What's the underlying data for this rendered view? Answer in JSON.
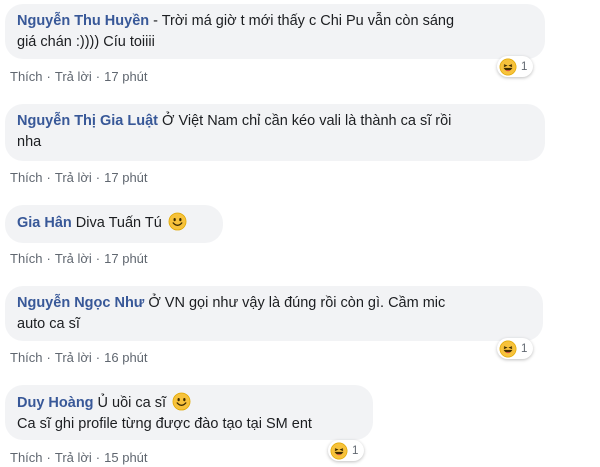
{
  "comments": [
    {
      "author": "Nguyễn Thu Huyền",
      "text_line1": "- Trời má giờ t mới thấy c Chi Pu vẫn còn sáng",
      "text_line2": "giá chán :)))) Cíu toiiii",
      "like": "Thích",
      "reply": "Trả lời",
      "time": "17 phút",
      "reaction_count": "1"
    },
    {
      "author": "Nguyễn Thị Gia Luật",
      "text_line1": "Ở Việt Nam chỉ cần kéo vali là thành ca sĩ rồi",
      "text_line2": "nha",
      "like": "Thích",
      "reply": "Trả lời",
      "time": "17 phút"
    },
    {
      "author": "Gia Hân",
      "text": "Diva Tuấn Tú",
      "like": "Thích",
      "reply": "Trả lời",
      "time": "17 phút"
    },
    {
      "author": "Nguyễn Ngọc Như",
      "text_line1": "Ở VN gọi như vậy là đúng rồi còn gì. Cầm mic",
      "text_line2": "auto ca sĩ",
      "like": "Thích",
      "reply": "Trả lời",
      "time": "16 phút",
      "reaction_count": "1"
    },
    {
      "author": "Duy Hoàng",
      "text_line1": "Ủ uồi ca sĩ",
      "text_line2": "Ca sĩ ghi profile từng được đào tạo tại SM ent",
      "like": "Thích",
      "reply": "Trả lời",
      "time": "15 phút",
      "reaction_count": "1"
    }
  ],
  "separator": "·",
  "colors": {
    "author": "#385898",
    "bubble": "#f2f3f5",
    "meta": "#606770",
    "emoji": "#f7c23b"
  }
}
